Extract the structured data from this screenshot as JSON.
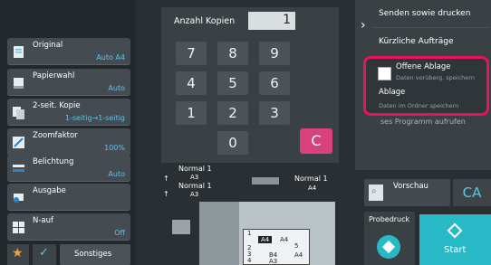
{
  "settings": [
    {
      "label": "Original",
      "value": "Auto A4"
    },
    {
      "label": "Papierwahl",
      "value": "Auto"
    },
    {
      "label": "2-seit. Kopie",
      "value": "1-seitig→1-seitig"
    },
    {
      "label": "Zoomfaktor",
      "value": "100%"
    },
    {
      "label": "Belichtung",
      "value": "Auto"
    },
    {
      "label": "Ausgabe",
      "value": ""
    },
    {
      "label": "N-auf",
      "value": "Off"
    }
  ],
  "bottom_bar": {
    "others_label": "Sonstiges"
  },
  "copies": {
    "label": "Anzahl Kopien",
    "value": "1"
  },
  "keypad": {
    "keys": [
      "7",
      "8",
      "9",
      "4",
      "5",
      "6",
      "1",
      "2",
      "3",
      "0"
    ],
    "clear": "C"
  },
  "right": {
    "send_print": "Senden sowie drucken",
    "recent_jobs": "Kürzliche Aufträge",
    "temp_store_title": "Offene Ablage",
    "temp_store_sub": "Daten vorüberg. speichern",
    "store_title": "Ablage",
    "store_sub": "Daten im Ordner speichern",
    "obscured_text": "ses Programm aufrufen",
    "preview": "Vorschau",
    "ca": "CA",
    "proof": "Probedruck",
    "start": "Start"
  },
  "diagram": {
    "orig_size": "Normal 1",
    "orig_paper": "A3",
    "out_size": "Normal 1",
    "out_paper": "A3",
    "tray_size": "Normal 1",
    "tray_paper": "A4",
    "trays": [
      "1",
      "A4",
      "2",
      "A4",
      "3",
      "B4",
      "4",
      "A3",
      "5",
      "A4"
    ]
  },
  "colors": {
    "accent": "#5ec3ea",
    "highlight": "#e4165a",
    "start": "#27b9c6",
    "clear": "#d8417c"
  }
}
